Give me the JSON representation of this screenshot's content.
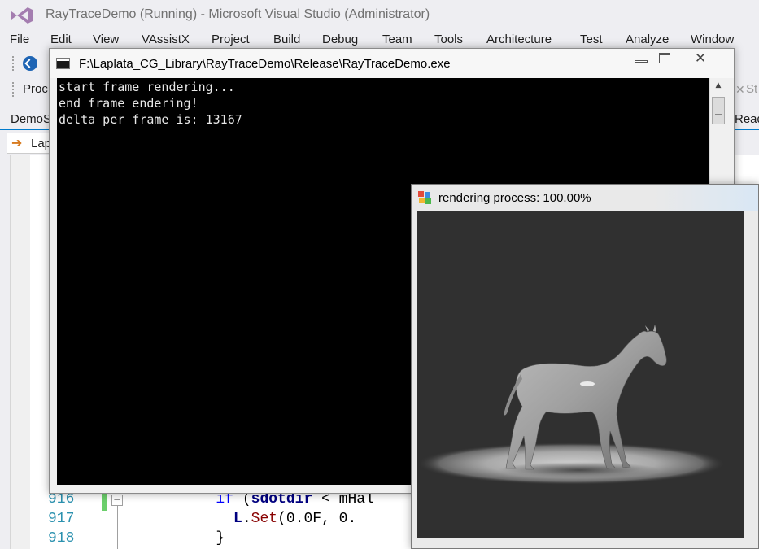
{
  "vs": {
    "title": "RayTraceDemo (Running) - Microsoft Visual Studio (Administrator)",
    "menu": [
      "File",
      "Edit",
      "View",
      "VAssistX",
      "Project",
      "Build",
      "Debug",
      "Team",
      "Tools",
      "Architecture",
      "Test",
      "Analyze",
      "Window"
    ],
    "toolbar": {
      "process_label": "Proc",
      "start_label": "St"
    },
    "tabs": {
      "doc_tab": "DemoS",
      "right_tab": "Read"
    },
    "navbar": {
      "label": "Lap"
    },
    "editor": {
      "lines": [
        {
          "no": "916",
          "indent": "        ",
          "kw": "if",
          "open": " (",
          "id": "sdotdir",
          "rest": " < mHal"
        },
        {
          "no": "917",
          "indent": "          ",
          "obj": "L",
          "dot": ".",
          "fn": "Set",
          "rest": "(0.0F, 0."
        },
        {
          "no": "918",
          "indent": "        ",
          "rest": "}"
        }
      ]
    }
  },
  "console": {
    "title": "F:\\Laplata_CG_Library\\RayTraceDemo\\Release\\RayTraceDemo.exe",
    "close_glyph": "✕",
    "lines": [
      "start frame rendering...",
      "end frame endering!",
      "delta per frame is: 13167"
    ]
  },
  "render": {
    "title": "rendering process: 100.00%",
    "progress_percent": 100.0
  },
  "colors": {
    "vs_accent": "#007acc",
    "console_bg": "#000000",
    "render_bg": "#303030"
  }
}
